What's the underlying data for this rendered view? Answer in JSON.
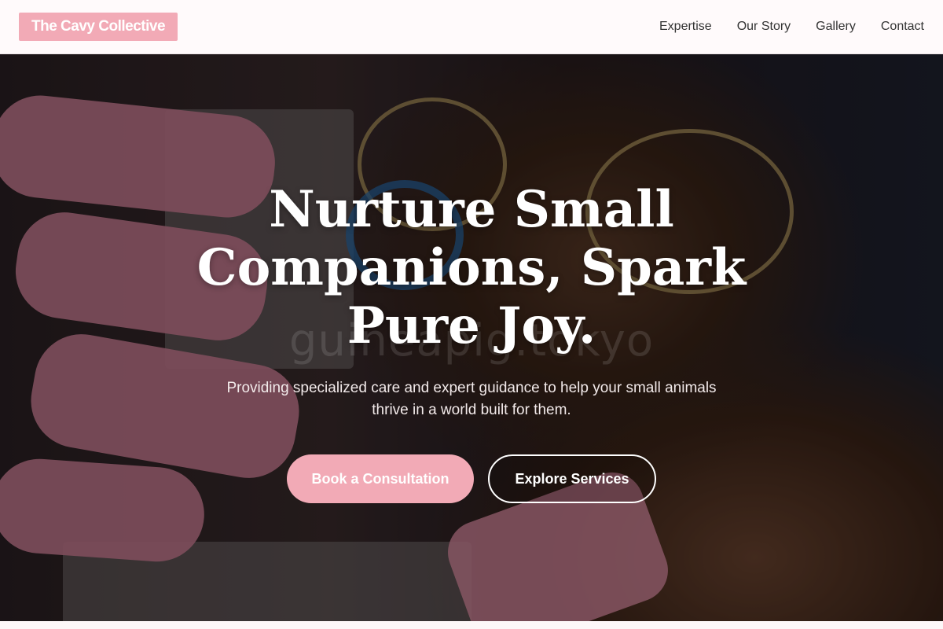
{
  "brand": {
    "name": "The Cavy Collective"
  },
  "nav": {
    "links": [
      "Expertise",
      "Our Story",
      "Gallery",
      "Contact"
    ]
  },
  "hero": {
    "headline": "Nurture Small Companions, Spark Pure Joy.",
    "subtext": "Providing specialized care and expert guidance to help your small animals thrive in a world built for them.",
    "watermark": "guineapig.tokyo",
    "primary_cta": "Book a Consultation",
    "secondary_cta": "Explore Services"
  },
  "colors": {
    "accent": "#f2aab6",
    "nav_background": "#fffafb",
    "hero_overlay": "#000000"
  }
}
